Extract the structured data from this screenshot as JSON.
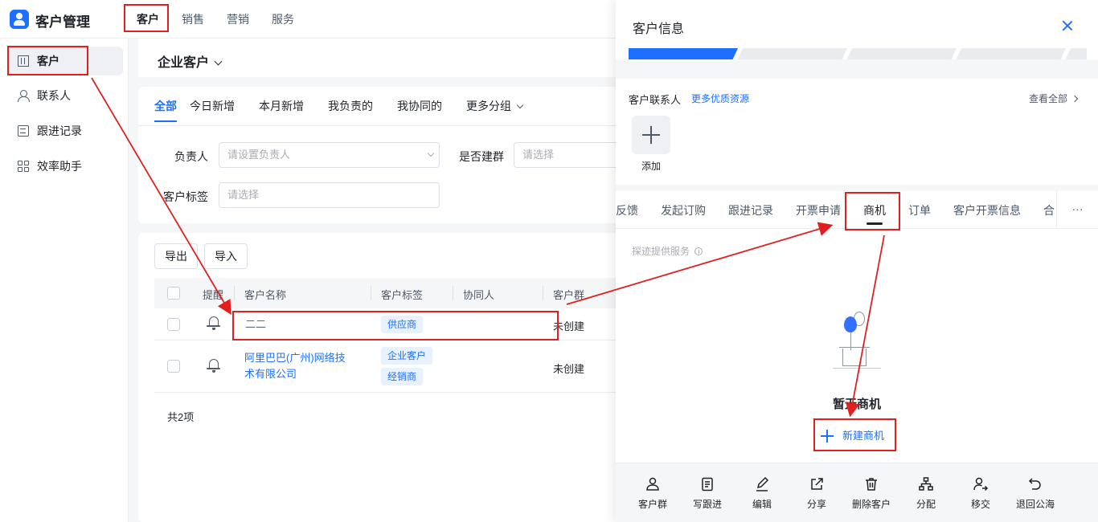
{
  "app": {
    "title": "客户管理"
  },
  "topnav": [
    "客户",
    "销售",
    "营销",
    "服务"
  ],
  "sidebar": {
    "items": [
      "客户",
      "联系人",
      "跟进记录",
      "效率助手"
    ]
  },
  "page": {
    "title": "企业客户"
  },
  "filters": {
    "tabs": [
      "全部",
      "今日新增",
      "本月新增",
      "我负责的",
      "我协同的",
      "更多分组"
    ],
    "owner_label": "负责人",
    "owner_placeholder": "请设置负责人",
    "group_label": "是否建群",
    "group_placeholder": "请选择",
    "tag_label": "客户标签",
    "tag_placeholder": "请选择"
  },
  "table": {
    "buttons": [
      "导出",
      "导入"
    ],
    "headers": [
      "提醒",
      "客户名称",
      "客户标签",
      "协同人",
      "客户群"
    ],
    "rows": [
      {
        "name": "二二",
        "tags": [
          "供应商"
        ],
        "group": "未创建"
      },
      {
        "name_line1": "阿里巴巴(广州)网络技",
        "name_line2": "术有限公司",
        "tags": [
          "企业客户",
          "经销商"
        ],
        "group": "未创建"
      }
    ],
    "total": "共2项"
  },
  "drawer": {
    "title": "客户信息",
    "contacts_title": "客户联系人",
    "more_resources": "更多优质资源",
    "view_all": "查看全部",
    "add_label": "添加",
    "tabs": [
      "反馈",
      "发起订购",
      "跟进记录",
      "开票申请",
      "商机",
      "订单",
      "客户开票信息",
      "合"
    ],
    "more": "···",
    "hint": "探迹提供服务",
    "empty_text": "暂无商机",
    "new_button": "新建商机",
    "actions": [
      "客户群",
      "写跟进",
      "编辑",
      "分享",
      "删除客户",
      "分配",
      "移交",
      "退回公海"
    ]
  },
  "colors": {
    "accent": "#1e6fff",
    "annotation": "#e02020",
    "tag_bg": "#e8f1ff"
  }
}
